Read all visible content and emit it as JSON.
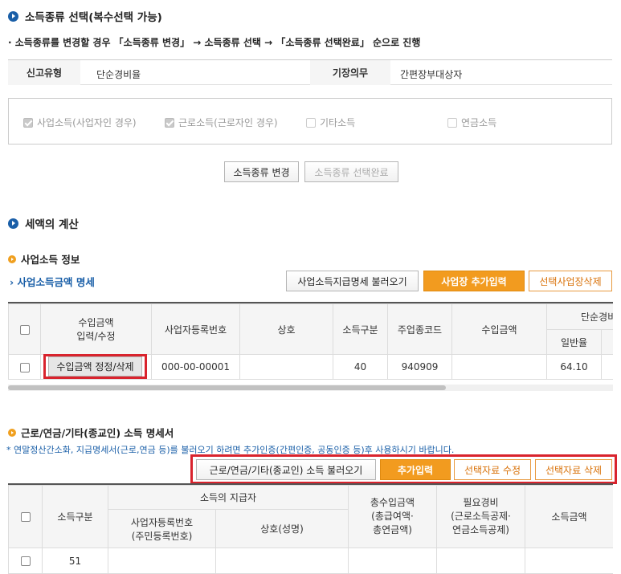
{
  "section1": {
    "title": "소득종류 선택(복수선택 가능)",
    "instruction": "· 소득종류를 변경할 경우 「소득종류 변경」 → 소득종류 선택 → 「소득종류 선택완료」 순으로 진행",
    "filing_type_label": "신고유형",
    "filing_type_value": "단순경비율",
    "bookkeeping_label": "기장의무",
    "bookkeeping_value": "간편장부대상자",
    "income_types": [
      {
        "label": "사업소득(사업자인 경우)",
        "checked": true
      },
      {
        "label": "근로소득(근로자인 경우)",
        "checked": true
      },
      {
        "label": "기타소득",
        "checked": false
      },
      {
        "label": "연금소득",
        "checked": false
      }
    ],
    "change_button": "소득종류 변경",
    "complete_button": "소득종류 선택완료"
  },
  "section2": {
    "title": "세액의 계산",
    "business": {
      "title": "사업소득 정보",
      "link": "› 사업소득금액 명세",
      "load_button": "사업소득지급명세 불러오기",
      "add_button": "사업장 추가입력",
      "delete_button": "선택사업장삭제",
      "headers": {
        "income_input": "수입금액\n입력/수정",
        "biz_no": "사업자등록번호",
        "name": "상호",
        "income_class": "소득구분",
        "industry_code": "주업종코드",
        "revenue": "수입금액",
        "simple_rate": "단순경비",
        "general_rate": "일반율"
      },
      "rows": [
        {
          "edit_button": "수입금액 정정/삭제",
          "biz_no": "000-00-00001",
          "name": "",
          "income_class": "40",
          "industry_code": "940909",
          "revenue": "",
          "general_rate": "64.10"
        }
      ]
    },
    "other": {
      "title": "근로/연금/기타(종교인) 소득 명세서",
      "note": "* 연말정산간소화, 지급명세서(근로,연금 등)를 불러오기 하려면 추가인증(간편인증, 공동인증 등)후 사용하시기 바랍니다.",
      "load_button": "근로/연금/기타(종교인) 소득 불러오기",
      "add_button": "추가입력",
      "edit_button": "선택자료 수정",
      "delete_button": "선택자료 삭제",
      "headers": {
        "income_class": "소득구분",
        "payer": "소득의 지급자",
        "biz_no": "사업자등록번호\n(주민등록번호)",
        "name": "상호(성명)",
        "total": "총수입금액\n(총급여액·\n총연금액)",
        "expense": "필요경비\n(근로소득공제·\n연금소득공제)",
        "income": "소득금액"
      },
      "rows": [
        {
          "income_class": "51"
        }
      ]
    }
  }
}
